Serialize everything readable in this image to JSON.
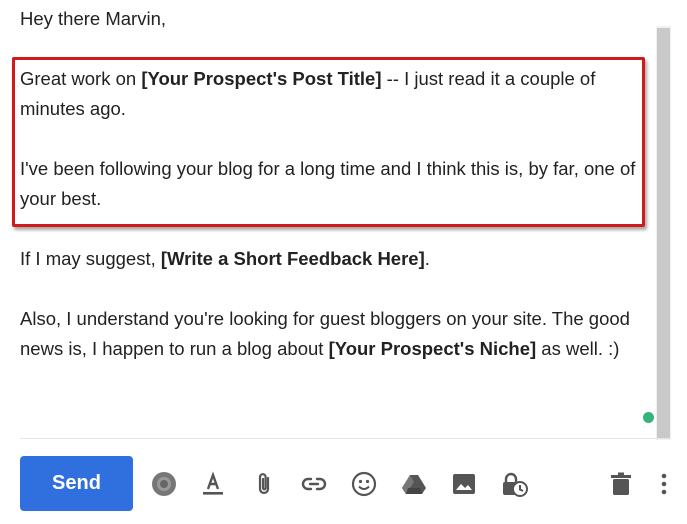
{
  "email": {
    "greeting": "Hey there Marvin,",
    "p1_pre": "Great work on ",
    "p1_bold": "[Your Prospect's Post Title]",
    "p1_post": " -- I just read it a couple of minutes ago.",
    "p2": "I've been following your blog for a long time and I think this is, by far, one of your best.",
    "p3_pre": "If I may suggest, ",
    "p3_bold": "[Write a Short Feedback Here]",
    "p3_post": ".",
    "p4_pre": "Also, I understand you're looking for guest bloggers on your site. The good news is, I happen to run a blog about ",
    "p4_bold": "[Your Prospect's Niche]",
    "p4_post": " as well. :)"
  },
  "toolbar": {
    "send_label": "Send",
    "icons": [
      "loading-spinner-icon",
      "text-format-icon",
      "attach-icon",
      "link-icon",
      "emoji-icon",
      "drive-icon",
      "image-icon",
      "confidential-mode-icon",
      "trash-icon",
      "more-options-icon"
    ]
  },
  "colors": {
    "send_button": "#2f6fde",
    "highlight_border": "#d11a1a",
    "status_dot": "#34b37b",
    "icon": "#555555"
  }
}
